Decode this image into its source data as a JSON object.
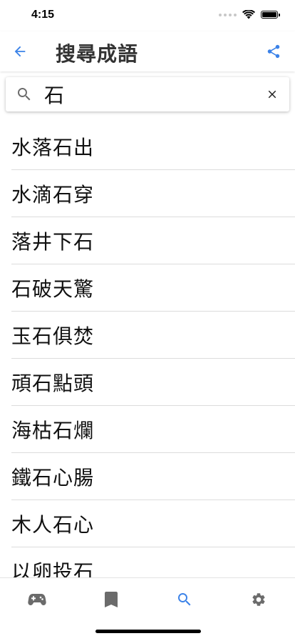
{
  "status_bar": {
    "time": "4:15"
  },
  "app_bar": {
    "title": "搜尋成語",
    "back_icon": "arrow-back-icon",
    "share_icon": "share-icon",
    "accent_color": "#3b82e8"
  },
  "search": {
    "value": "石",
    "search_icon": "search-icon",
    "clear_icon": "close-icon"
  },
  "results": [
    "水落石出",
    "水滴石穿",
    "落井下石",
    "石破天驚",
    "玉石俱焚",
    "頑石點頭",
    "海枯石爛",
    "鐵石心腸",
    "木人石心",
    "以卵投石"
  ],
  "bottom_nav": {
    "items": [
      {
        "icon": "gamepad-icon",
        "active": false
      },
      {
        "icon": "bookmark-icon",
        "active": false
      },
      {
        "icon": "search-icon",
        "active": true
      },
      {
        "icon": "gear-icon",
        "active": false
      }
    ],
    "active_color": "#3b82e8",
    "inactive_color": "#6b6b6b"
  }
}
